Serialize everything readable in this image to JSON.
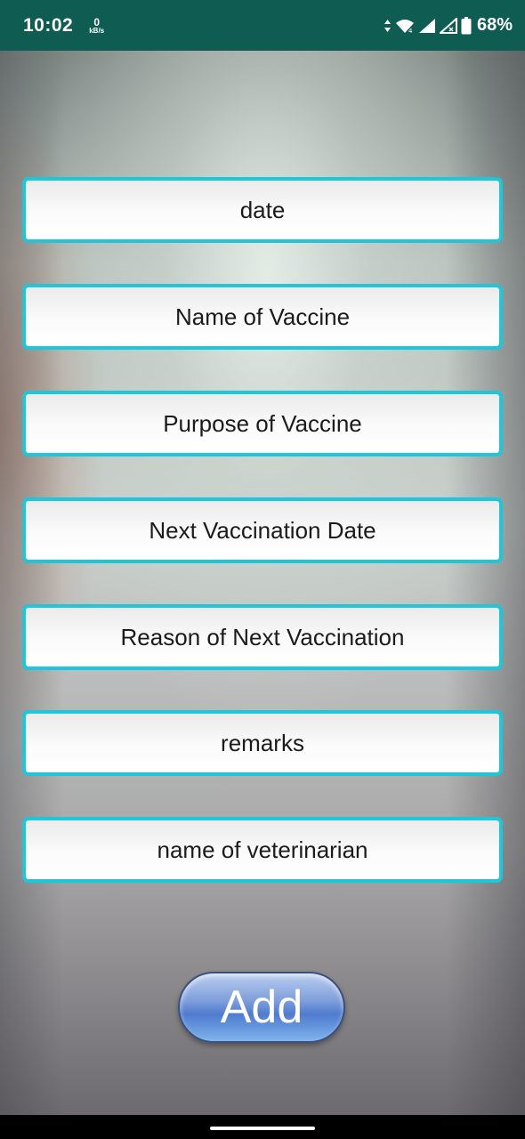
{
  "status_bar": {
    "time": "10:02",
    "speed_value": "0",
    "speed_unit": "kB/s",
    "battery_percent": "68%",
    "icons": [
      "data-arrows-icon",
      "wifi-icon",
      "signal-icon",
      "signal-no-service-icon",
      "battery-icon"
    ]
  },
  "form": {
    "fields": [
      {
        "label": "date"
      },
      {
        "label": "Name of Vaccine"
      },
      {
        "label": "Purpose of Vaccine"
      },
      {
        "label": "Next Vaccination Date"
      },
      {
        "label": "Reason of Next Vaccination"
      },
      {
        "label": "remarks"
      },
      {
        "label": "name of veterinarian"
      }
    ],
    "add_label": "Add"
  },
  "colors": {
    "status_bar": "#0f5c52",
    "field_border": "#1ec6d9",
    "add_button": "#4f7bcf"
  }
}
